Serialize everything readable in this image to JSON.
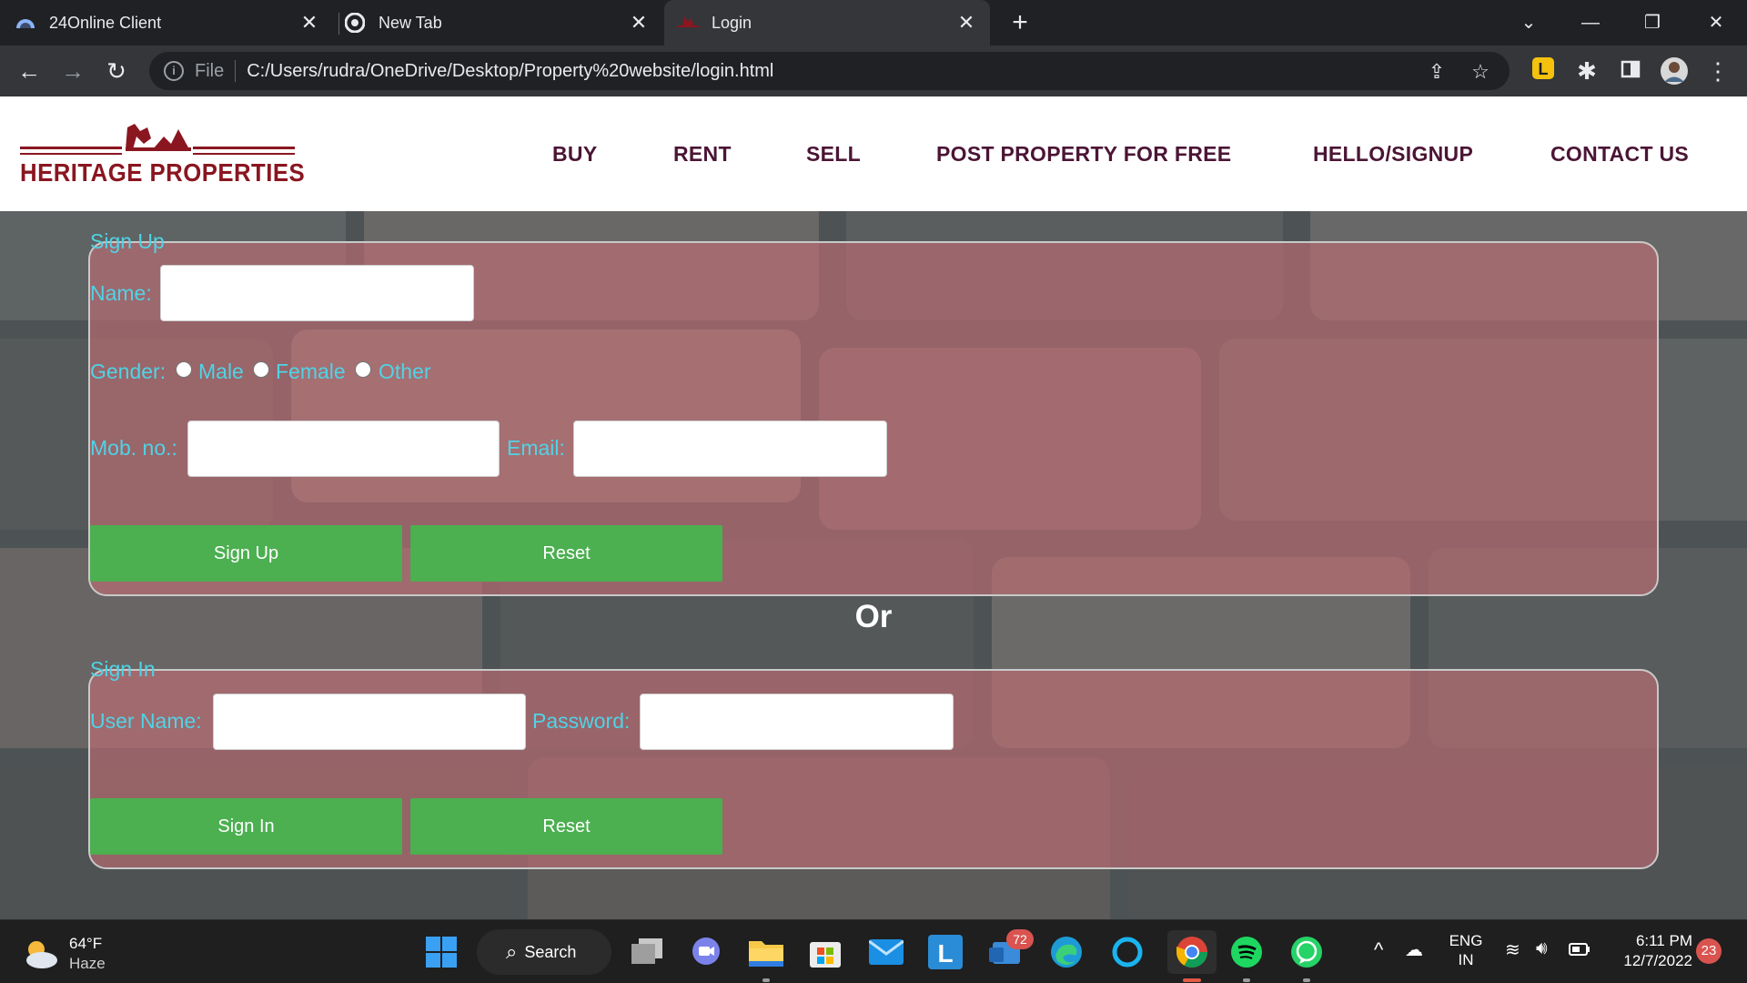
{
  "browser": {
    "tabs": [
      {
        "title": "24Online Client",
        "active": false,
        "icon": "cloud-favicon-icon"
      },
      {
        "title": "New Tab",
        "active": false,
        "icon": "chrome-favicon-icon"
      },
      {
        "title": "Login",
        "active": true,
        "icon": "heritage-favicon-icon"
      }
    ],
    "address": {
      "scheme_label": "File",
      "url": "C:/Users/rudra/OneDrive/Desktop/Property%20website/login.html"
    }
  },
  "site": {
    "logo_text": "HERITAGE PROPERTIES",
    "nav": [
      "BUY",
      "RENT",
      "SELL",
      "POST PROPERTY FOR FREE",
      "HELLO/SIGNUP",
      "CONTACT US"
    ],
    "signup": {
      "legend": "Sign Up",
      "name_label": "Name:",
      "gender_label": "Gender:",
      "gender_options": [
        "Male",
        "Female",
        "Other"
      ],
      "mobile_label": "Mob. no.:",
      "email_label": "Email:",
      "submit_label": "Sign Up",
      "reset_label": "Reset",
      "name_value": "",
      "mobile_value": "",
      "email_value": ""
    },
    "separator": "Or",
    "signin": {
      "legend": "Sign In",
      "username_label": "User Name:",
      "password_label": "Password:",
      "submit_label": "Sign In",
      "reset_label": "Reset",
      "username_value": "",
      "password_value": ""
    }
  },
  "taskbar": {
    "weather_temp": "64°F",
    "weather_condition": "Haze",
    "search_label": "Search",
    "teams_badge": "72",
    "lang_primary": "ENG",
    "lang_secondary": "IN",
    "time": "6:11 PM",
    "date": "12/7/2022",
    "notification_count": "23"
  },
  "colors": {
    "brand": "#8a1620",
    "nav": "#4b1535",
    "label": "#4fd3e6",
    "button": "#4caf50",
    "panel": "#c46e74"
  }
}
